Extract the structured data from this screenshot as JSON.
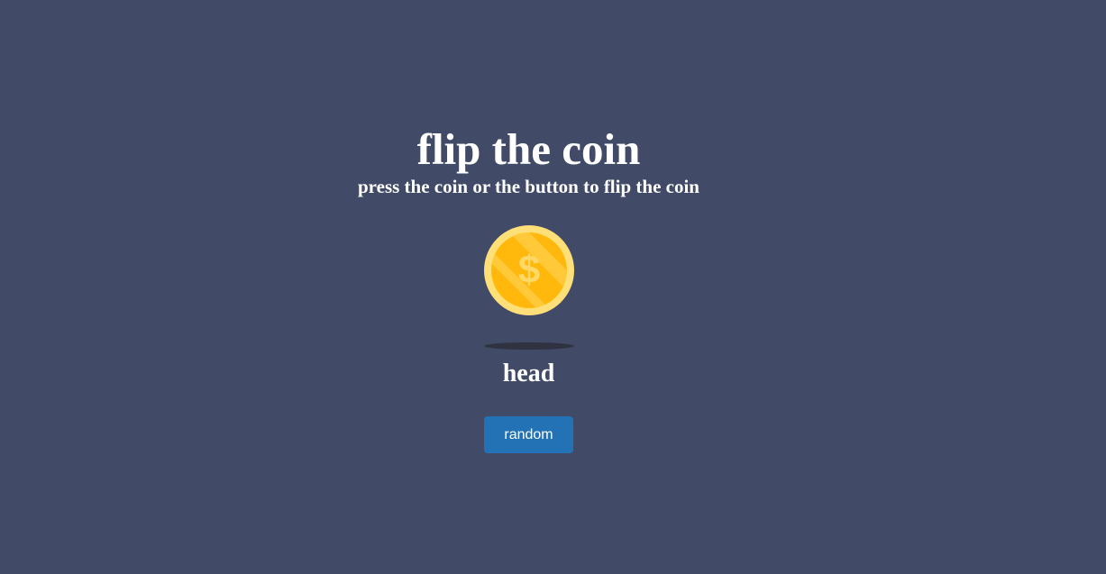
{
  "header": {
    "title": "flip the coin",
    "subtitle": "press the coin or the button to flip the coin"
  },
  "coin": {
    "icon": "dollar-coin-icon",
    "symbol": "$",
    "colors": {
      "rim": "#ffe078",
      "face": "#ffb80b",
      "stripe": "#ffc93a",
      "symbol": "#ffd866"
    }
  },
  "result": {
    "text": "head"
  },
  "controls": {
    "random_label": "random"
  },
  "colors": {
    "background": "#414b67",
    "button": "#2372b6",
    "text": "#ffffff"
  }
}
